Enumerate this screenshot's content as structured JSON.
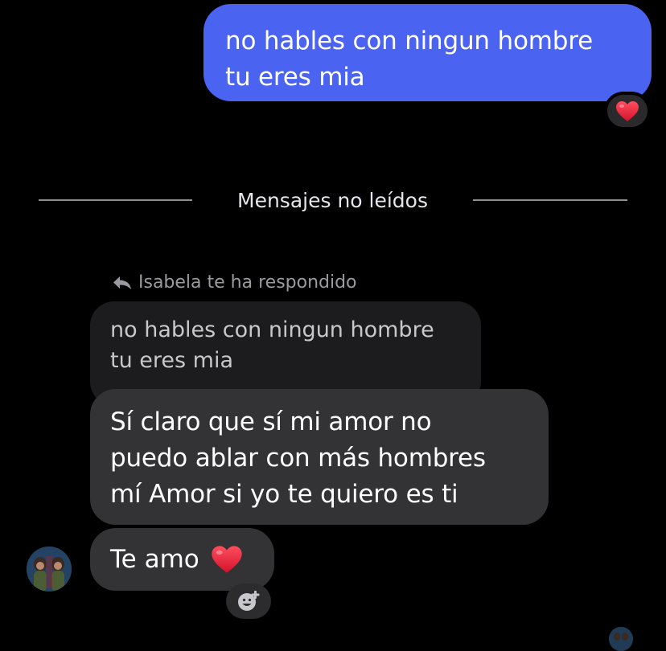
{
  "outgoing": {
    "text": "no hables con ningun hombre\ntu eres mia",
    "reaction": "heart-emoji"
  },
  "divider": {
    "label": "Mensajes no leídos"
  },
  "incoming": {
    "reply_header": "Isabela te ha respondido",
    "quoted_text": "no hables con ningun hombre\ntu eres mia",
    "message_1": "Sí claro que sí mi amor no\npuedo ablar con más hombres\nmí Amor si yo te quiero es ti",
    "message_2": "Te amo",
    "message_2_emoji": "heart-emoji"
  },
  "colors": {
    "background": "#000000",
    "outgoing_bubble": "#4a63f0",
    "incoming_bubble": "#333335",
    "quoted_bubble": "#1c1c1e",
    "heart": "#e0243b"
  },
  "icons": {
    "reply": "reply-arrow-icon",
    "add_reaction": "add-reaction-icon",
    "heart": "heart-icon"
  }
}
